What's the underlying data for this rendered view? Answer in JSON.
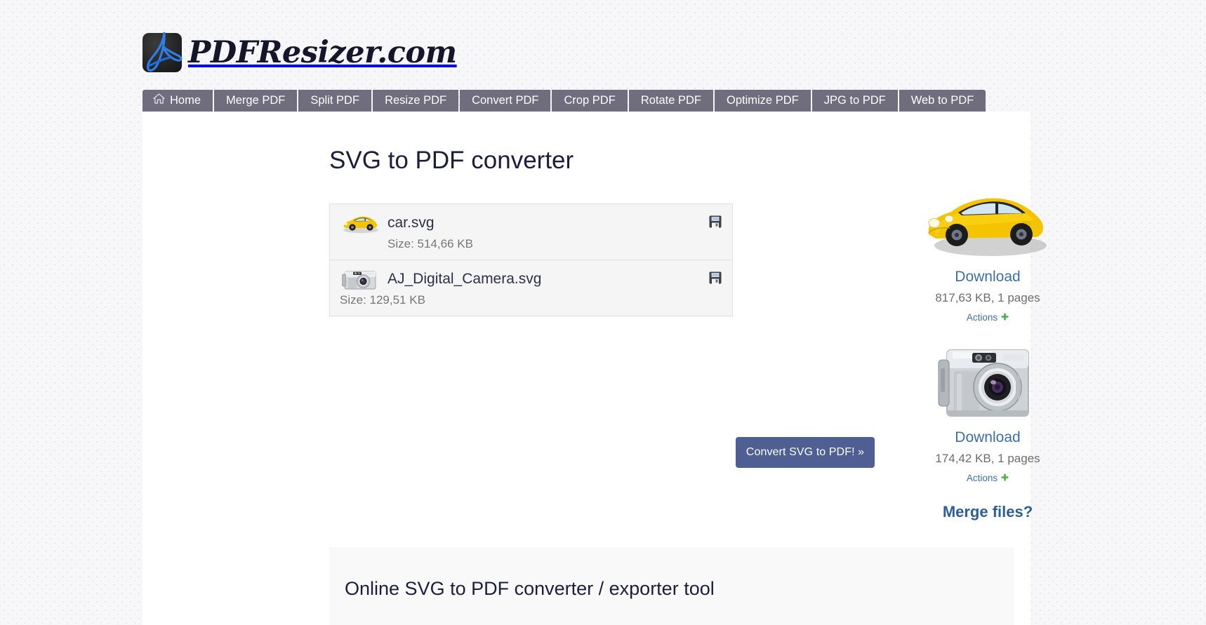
{
  "site": {
    "logo_text": "PDFResizer.com",
    "logo_icon": "pdf-document-icon"
  },
  "nav": {
    "items": [
      {
        "label": "Home",
        "icon": "home-icon",
        "active": true
      },
      {
        "label": "Merge PDF",
        "icon": null,
        "active": false
      },
      {
        "label": "Split PDF",
        "icon": null,
        "active": false
      },
      {
        "label": "Resize PDF",
        "icon": null,
        "active": false
      },
      {
        "label": "Convert PDF",
        "icon": null,
        "active": false
      },
      {
        "label": "Crop PDF",
        "icon": null,
        "active": false
      },
      {
        "label": "Rotate PDF",
        "icon": null,
        "active": false
      },
      {
        "label": "Optimize PDF",
        "icon": null,
        "active": false
      },
      {
        "label": "JPG to PDF",
        "icon": null,
        "active": false
      },
      {
        "label": "Web to PDF",
        "icon": null,
        "active": false
      }
    ]
  },
  "main": {
    "page_title": "SVG to PDF converter",
    "convert_button_label": "Convert SVG to PDF! »",
    "files": [
      {
        "name": "car.svg",
        "size_label": "Size: 514,66 KB",
        "thumb_icon": "yellow-sports-car-thumbnail",
        "save_icon": "floppy-save-icon"
      },
      {
        "name": "AJ_Digital_Camera.svg",
        "size_label": "Size: 129,51 KB",
        "thumb_icon": "digital-camera-thumbnail",
        "save_icon": "floppy-save-icon"
      }
    ]
  },
  "results": {
    "items": [
      {
        "thumb_icon": "yellow-sports-car-preview",
        "download_label": "Download",
        "meta": "817,63 KB, 1 pages",
        "actions_label": "Actions",
        "actions_icon": "green-plus-icon"
      },
      {
        "thumb_icon": "digital-camera-preview",
        "download_label": "Download",
        "meta": "174,42 KB, 1 pages",
        "actions_label": "Actions",
        "actions_icon": "green-plus-icon"
      }
    ],
    "merge_link_label": "Merge files?"
  },
  "info_panel": {
    "heading": "Online SVG to PDF converter / exporter tool"
  },
  "colors": {
    "nav_background": "#6f6d7e",
    "convert_button": "#4f5f93",
    "link_blue": "#3d6fa8",
    "merge_link_blue": "#2c5f96",
    "heading_navy": "#1b1f3b",
    "actions_green": "#45b049",
    "page_background": "#f7f7f9",
    "content_background": "#ffffff"
  }
}
